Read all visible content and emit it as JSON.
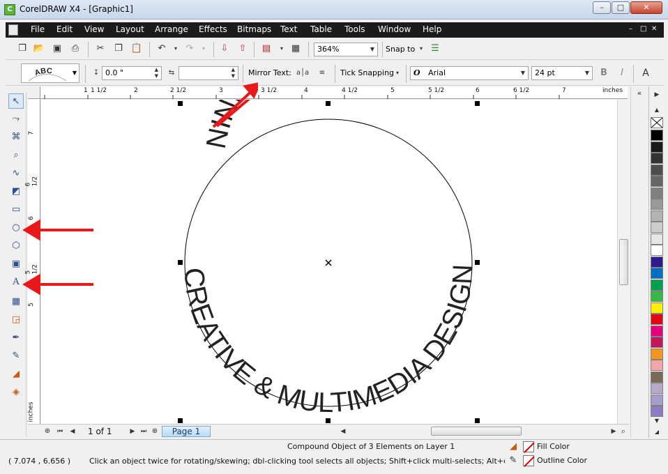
{
  "window": {
    "title": "CorelDRAW X4 - [Graphic1]",
    "min": "–",
    "max": "□",
    "close": "✕"
  },
  "menubar": {
    "items": [
      "File",
      "Edit",
      "View",
      "Layout",
      "Arrange",
      "Effects",
      "Bitmaps",
      "Text",
      "Table",
      "Tools",
      "Window",
      "Help"
    ],
    "mdi_min": "–",
    "mdi_max": "□",
    "mdi_close": "✕"
  },
  "standard_toolbar": {
    "zoom_level": "364%",
    "snap_to": "Snap to"
  },
  "property_bar": {
    "text_on_path_preview": "ABC",
    "offset_value": "0.0 \"",
    "distance_value": "",
    "mirror_text_label": "Mirror Text:",
    "tick_snapping": "Tick Snapping",
    "font_name": "Arial",
    "font_size": "24 pt"
  },
  "rulers": {
    "unit": "inches",
    "h_labels": [
      "1",
      "1 1/2",
      "2",
      "2 1/2",
      "3",
      "3 1/2",
      "4",
      "4 1/2",
      "5",
      "5 1/2",
      "6",
      "6 1/2",
      "7"
    ],
    "v_labels": [
      "7",
      "6 1/2",
      "6",
      "5 1/2",
      "5"
    ],
    "v_unit": "inches"
  },
  "canvas": {
    "top_text": "NINEQUADRAT",
    "bottom_text": "CREATIVE & MULTIMEDIA DESIGN"
  },
  "page_nav": {
    "counter": "1 of 1",
    "tab": "Page 1"
  },
  "status": {
    "coordinates": "( 7.074 , 6.656 )",
    "object_info": "Compound Object of 3 Elements on Layer 1",
    "hint": "Click an object twice for rotating/skewing; dbl-clicking tool selects all objects; Shift+click multi-selects; Alt+click digs; Ctrl+...",
    "fill_label": "Fill Color",
    "outline_label": "Outline Color"
  },
  "palette_colors": [
    "#000000",
    "#1a1a1a",
    "#333333",
    "#4d4d4d",
    "#666666",
    "#808080",
    "#999999",
    "#b3b3b3",
    "#cccccc",
    "#e6e6e6",
    "#ffffff",
    "#2e1a8c",
    "#0070c0",
    "#00a050",
    "#39b54a",
    "#ffee00",
    "#e30613",
    "#e4007c",
    "#c2185b",
    "#f7941d",
    "#f4a6a6",
    "#7b6a58",
    "#b8a9c9",
    "#a89cc8",
    "#8e7cc3"
  ],
  "accent": {
    "arrow": "#e8191b",
    "selection": "#000000"
  }
}
